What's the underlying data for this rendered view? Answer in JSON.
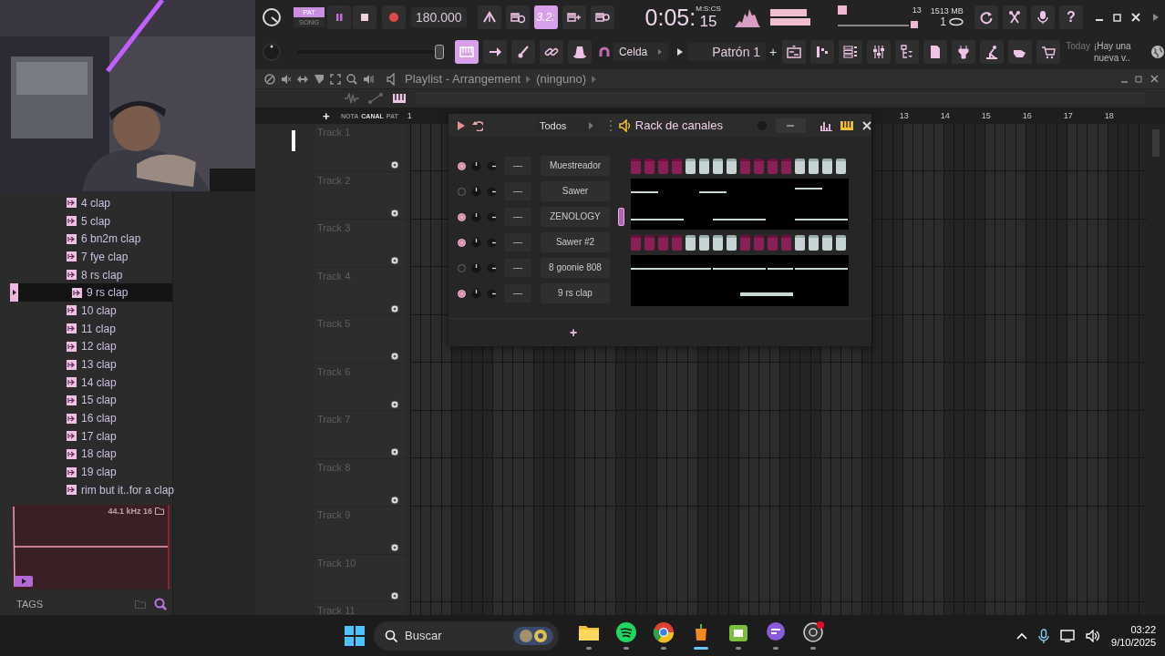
{
  "toolbar": {
    "mode": [
      {
        "label": "PAT",
        "selected": true
      },
      {
        "label": "SONG",
        "selected": false
      }
    ],
    "tempo": "180.000",
    "step_snap": {
      "label": "3.2:",
      "on": true
    },
    "time": "0:05:",
    "master_slider": {
      "level": 0.96
    },
    "time_cs": "15",
    "time_unit": "M:S:CS",
    "voices": "13",
    "memory": "1513 MB",
    "cpu": "1",
    "help": "?",
    "typing_keyboard": {
      "on": true
    },
    "snap": "Celda",
    "pattern": "Patrón 1",
    "pattern_add": "+",
    "news_label": "Today",
    "news": "¡Hay una nueva v.."
  },
  "browser": {
    "items": [
      {
        "label": "4 clap",
        "selected": false
      },
      {
        "label": "5 clap",
        "selected": false
      },
      {
        "label": "6 bn2m clap",
        "selected": false
      },
      {
        "label": "7 fye clap",
        "selected": false
      },
      {
        "label": "8 rs clap",
        "selected": false
      },
      {
        "label": "9 rs clap",
        "selected": true
      },
      {
        "label": "10 clap",
        "selected": false
      },
      {
        "label": "11 clap",
        "selected": false
      },
      {
        "label": "12 clap",
        "selected": false
      },
      {
        "label": "13 clap",
        "selected": false
      },
      {
        "label": "14 clap",
        "selected": false
      },
      {
        "label": "15 clap",
        "selected": false
      },
      {
        "label": "16 clap",
        "selected": false
      },
      {
        "label": "17 clap",
        "selected": false
      },
      {
        "label": "18 clap",
        "selected": false
      },
      {
        "label": "19 clap",
        "selected": false
      },
      {
        "label": "rim but it..for a clap",
        "selected": false
      }
    ],
    "sample_info": "44.1 kHz 16",
    "tags_label": "TAGS"
  },
  "playlist": {
    "title": "Playlist - Arrangement",
    "target": "(ninguno)",
    "add": "+",
    "tabs": [
      {
        "label": "NOTA",
        "selected": false
      },
      {
        "label": "CANAL",
        "selected": true
      },
      {
        "label": "PAT",
        "selected": false
      }
    ],
    "ruler": [
      "1",
      "13",
      "14",
      "15",
      "16",
      "17",
      "18"
    ],
    "tracks": [
      "Track 1",
      "Track 2",
      "Track 3",
      "Track 4",
      "Track 5",
      "Track 6",
      "Track 7",
      "Track 8",
      "Track 9",
      "Track 10",
      "Track 11"
    ]
  },
  "channel_rack": {
    "filter": "Todos",
    "swing": {
      "level": 0.5
    },
    "title": "Rack de canales",
    "add": "+",
    "channels": [
      {
        "name": "Muestreador",
        "kind": "steps",
        "on": true,
        "selected": false,
        "mixer": "—"
      },
      {
        "name": "Sawer",
        "kind": "roll",
        "on": false,
        "selected": false,
        "mixer": "—"
      },
      {
        "name": "ZENOLOGY",
        "kind": "roll",
        "on": true,
        "selected": true,
        "mixer": "—"
      },
      {
        "name": "Sawer #2",
        "kind": "steps",
        "on": true,
        "selected": false,
        "mixer": "—"
      },
      {
        "name": "8 goonie 808",
        "kind": "roll",
        "on": false,
        "selected": false,
        "mixer": "—"
      },
      {
        "name": "9 rs clap",
        "kind": "roll",
        "on": true,
        "selected": false,
        "mixer": "—"
      }
    ]
  },
  "taskbar": {
    "search_placeholder": "Buscar",
    "time": "03:22",
    "date": "9/10/2025"
  }
}
